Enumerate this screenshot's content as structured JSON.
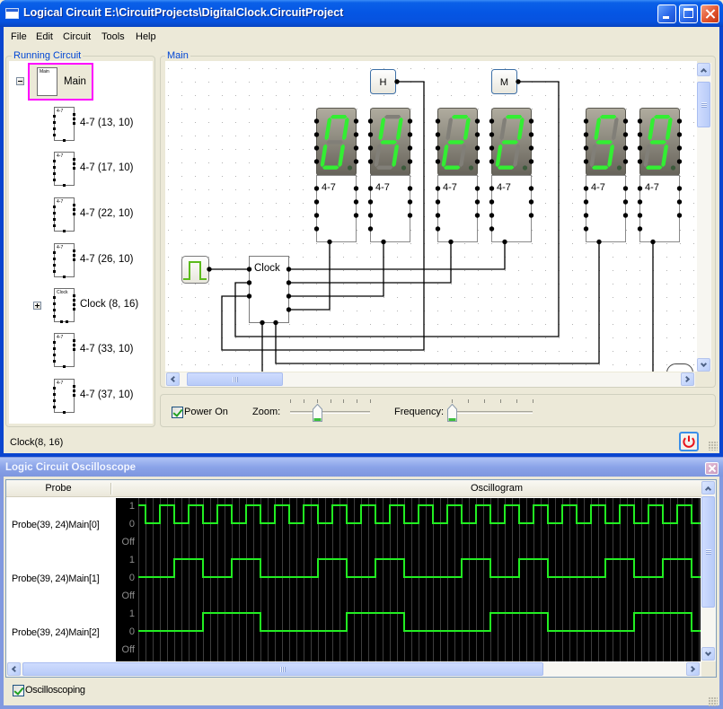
{
  "theme": {
    "group_title_color": "#0046d5",
    "selection_border": "#ff00ff"
  },
  "window": {
    "title": "Logical Circuit E:\\CircuitProjects\\DigitalClock.CircuitProject",
    "controls": [
      "minimize",
      "maximize",
      "close"
    ]
  },
  "menu": {
    "items": [
      "File",
      "Edit",
      "Circuit",
      "Tools",
      "Help"
    ]
  },
  "running_circuit": {
    "title": "Running Circuit",
    "root": {
      "label": "Main",
      "icon_label": "Main",
      "expanded": true,
      "selected": true
    },
    "children": [
      {
        "label": "4-7 (13, 10)",
        "icon_label": "4-7"
      },
      {
        "label": "4-7 (17, 10)",
        "icon_label": "4-7"
      },
      {
        "label": "4-7 (22, 10)",
        "icon_label": "4-7"
      },
      {
        "label": "4-7 (26, 10)",
        "icon_label": "4-7"
      },
      {
        "label": "Clock (8, 16)",
        "icon_label": "Clock",
        "expandable": true,
        "expanded": false
      },
      {
        "label": "4-7 (33, 10)",
        "icon_label": "4-7"
      },
      {
        "label": "4-7 (37, 10)",
        "icon_label": "4-7"
      }
    ]
  },
  "main_panel": {
    "title": "Main",
    "circuit": {
      "buttons": [
        {
          "label": "H"
        },
        {
          "label": "M"
        }
      ],
      "clock": {
        "label": "Clock"
      },
      "generator": {
        "icon": "pulse-generator-icon"
      },
      "displays": [
        {
          "label": "4-7",
          "digit": 0
        },
        {
          "label": "4-7",
          "digit": 4
        },
        {
          "label": "4-7",
          "digit": 2
        },
        {
          "label": "4-7",
          "digit": 2
        },
        {
          "label": "4-7",
          "digit": 5
        },
        {
          "label": "4-7",
          "digit": 9
        }
      ],
      "segment_colors": {
        "lit": "#33ee33",
        "unlit": "#817f78"
      }
    },
    "power_on": {
      "label": "Power On",
      "checked": true
    },
    "zoom": {
      "label": "Zoom:",
      "value": 2,
      "min": 0,
      "max": 6
    },
    "frequency": {
      "label": "Frequency:",
      "value": 0,
      "min": 0,
      "max": 5
    }
  },
  "status_bar": {
    "text": "Clock(8, 16)",
    "power_icon_color": "#e8141c"
  },
  "oscilloscope": {
    "title": "Logic Circuit Oscilloscope",
    "columns": {
      "probe": "Probe",
      "oscillogram": "Oscillogram"
    },
    "level_labels": {
      "high": "1",
      "low": "0",
      "off": "Off"
    },
    "trace_color": "#22ee22",
    "probes": [
      {
        "name": "Probe(39, 24)Main[0]",
        "samples": [
          1,
          0,
          1,
          0,
          1,
          0,
          1,
          0,
          1,
          0,
          1,
          0,
          1,
          0,
          1,
          0,
          1,
          0,
          1,
          0,
          1,
          0,
          1,
          0,
          1,
          0,
          1,
          0,
          1,
          0,
          1,
          0,
          1,
          0,
          1,
          0,
          1,
          0,
          1,
          0
        ]
      },
      {
        "name": "Probe(39, 24)Main[1]",
        "samples": [
          0,
          0,
          0,
          1,
          1,
          0,
          0,
          1,
          1,
          0,
          0,
          0,
          0,
          1,
          1,
          0,
          0,
          1,
          1,
          0,
          0,
          0,
          0,
          1,
          1,
          0,
          0,
          1,
          1,
          0,
          0,
          0,
          0,
          1,
          1,
          0,
          0,
          1,
          1,
          0
        ]
      },
      {
        "name": "Probe(39, 24)Main[2]",
        "samples": [
          0,
          0,
          0,
          0,
          0,
          1,
          1,
          1,
          1,
          0,
          0,
          0,
          0,
          0,
          0,
          1,
          1,
          1,
          1,
          0,
          0,
          0,
          0,
          0,
          0,
          1,
          1,
          1,
          1,
          0,
          0,
          0,
          0,
          0,
          0,
          1,
          1,
          1,
          1,
          0
        ]
      }
    ],
    "oscilloscoping": {
      "label": "Oscilloscoping",
      "checked": true
    }
  }
}
